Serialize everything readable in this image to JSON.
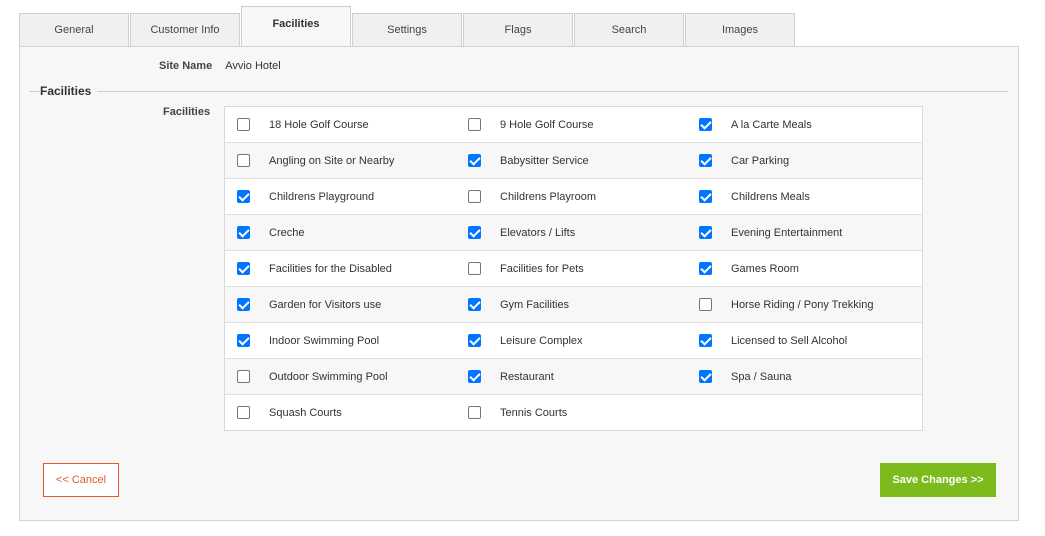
{
  "tabs": [
    {
      "label": "General",
      "active": false
    },
    {
      "label": "Customer Info",
      "active": false
    },
    {
      "label": "Facilities",
      "active": true
    },
    {
      "label": "Settings",
      "active": false
    },
    {
      "label": "Flags",
      "active": false
    },
    {
      "label": "Search",
      "active": false
    },
    {
      "label": "Images",
      "active": false
    }
  ],
  "site": {
    "label": "Site Name",
    "value": "Avvio Hotel"
  },
  "fieldset": {
    "legend": "Facilities",
    "field_label": "Facilities"
  },
  "facilities": [
    [
      {
        "label": "18 Hole Golf Course",
        "checked": false
      },
      {
        "label": "9 Hole Golf Course",
        "checked": false
      },
      {
        "label": "A la Carte Meals",
        "checked": true
      }
    ],
    [
      {
        "label": "Angling on Site or Nearby",
        "checked": false
      },
      {
        "label": "Babysitter Service",
        "checked": true
      },
      {
        "label": "Car Parking",
        "checked": true
      }
    ],
    [
      {
        "label": "Childrens Playground",
        "checked": true
      },
      {
        "label": "Childrens Playroom",
        "checked": false
      },
      {
        "label": "Childrens Meals",
        "checked": true
      }
    ],
    [
      {
        "label": "Creche",
        "checked": true
      },
      {
        "label": "Elevators / Lifts",
        "checked": true
      },
      {
        "label": "Evening Entertainment",
        "checked": true
      }
    ],
    [
      {
        "label": "Facilities for the Disabled",
        "checked": true
      },
      {
        "label": "Facilities for Pets",
        "checked": false
      },
      {
        "label": "Games Room",
        "checked": true
      }
    ],
    [
      {
        "label": "Garden for Visitors use",
        "checked": true
      },
      {
        "label": "Gym Facilities",
        "checked": true
      },
      {
        "label": "Horse Riding / Pony Trekking",
        "checked": false
      }
    ],
    [
      {
        "label": "Indoor Swimming Pool",
        "checked": true
      },
      {
        "label": "Leisure Complex",
        "checked": true
      },
      {
        "label": "Licensed to Sell Alcohol",
        "checked": true
      }
    ],
    [
      {
        "label": "Outdoor Swimming Pool",
        "checked": false
      },
      {
        "label": "Restaurant",
        "checked": true
      },
      {
        "label": "Spa / Sauna",
        "checked": true
      }
    ],
    [
      {
        "label": "Squash Courts",
        "checked": false
      },
      {
        "label": "Tennis Courts",
        "checked": false
      }
    ]
  ],
  "buttons": {
    "cancel": "<< Cancel",
    "save": "Save Changes >>"
  },
  "colors": {
    "accent_checkbox": "#0075ff",
    "save_bg": "#7dba1b",
    "cancel": "#e05a2b"
  }
}
